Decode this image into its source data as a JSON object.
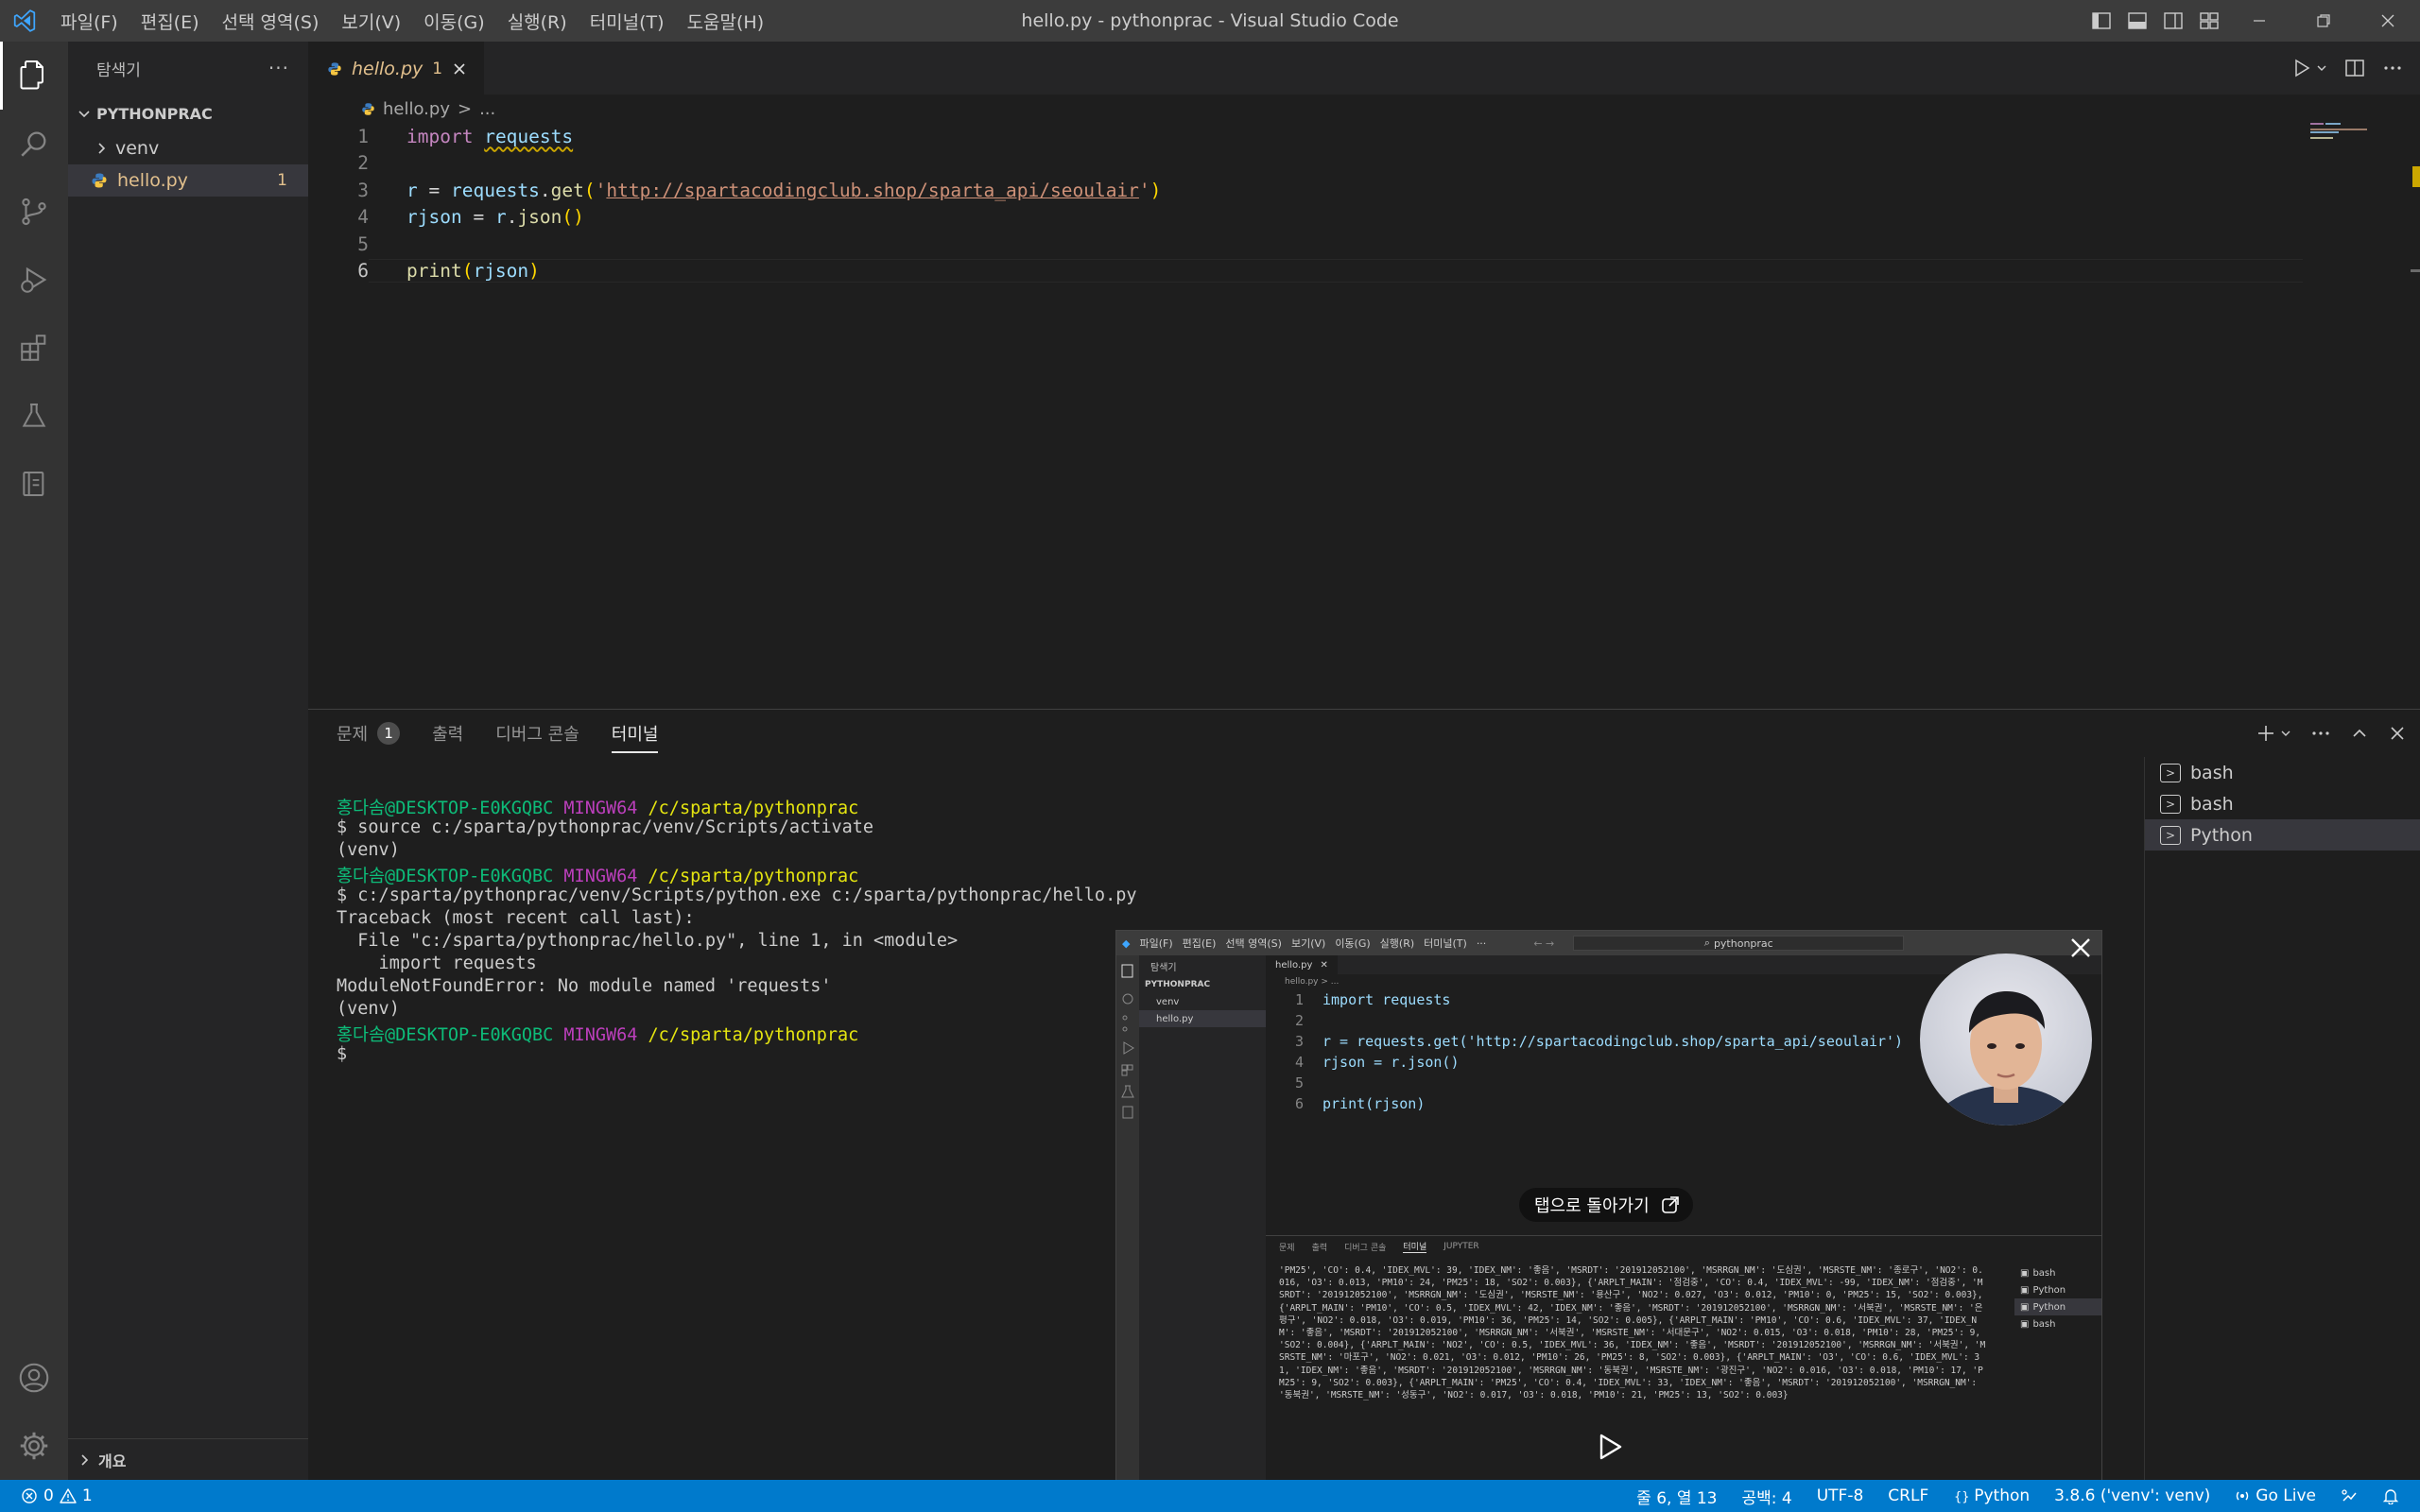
{
  "window": {
    "title": "hello.py - pythonprac - Visual Studio Code",
    "menu": [
      "파일(F)",
      "편집(E)",
      "선택 영역(S)",
      "보기(V)",
      "이동(G)",
      "실행(R)",
      "터미널(T)",
      "도움말(H)"
    ]
  },
  "sidebar": {
    "title": "탐색기",
    "more": "···",
    "folder": "PYTHONPRAC",
    "items": [
      {
        "label": "venv",
        "type": "folder"
      },
      {
        "label": "hello.py",
        "type": "file",
        "badge": "1"
      }
    ],
    "outline": "개요"
  },
  "editor": {
    "tab": {
      "name": "hello.py",
      "count": "1"
    },
    "breadcrumb": {
      "file": "hello.py",
      "sep": ">",
      "rest": "..."
    },
    "line_numbers": [
      "1",
      "2",
      "3",
      "4",
      "5",
      "6"
    ],
    "code": {
      "l1_kw": "import",
      "l1_mod": "requests",
      "l3_var": "r",
      "l3_eq": " = ",
      "l3_obj": "requests",
      "l3_dot": ".",
      "l3_fn": "get",
      "l3_open": "(",
      "l3_q1": "'",
      "l3_url": "http://spartacodingclub.shop/sparta_api/seoulair",
      "l3_q2": "'",
      "l3_close": ")",
      "l4_var": "rjson",
      "l4_eq": " = ",
      "l4_obj": "r",
      "l4_dot": ".",
      "l4_fn": "json",
      "l4_parens": "()",
      "l6_fn": "print",
      "l6_open": "(",
      "l6_arg": "rjson",
      "l6_close": ")"
    }
  },
  "panel": {
    "tabs": [
      {
        "label": "문제",
        "badge": "1"
      },
      {
        "label": "출력"
      },
      {
        "label": "디버그 콘솔"
      },
      {
        "label": "터미널",
        "active": true
      }
    ],
    "terminal": {
      "user": "홍다솜@DESKTOP-E0KGQBC",
      "host": "MINGW64",
      "path": "/c/sparta/pythonprac",
      "lines": [
        "$ source c:/sparta/pythonprac/venv/Scripts/activate",
        "(venv)",
        "$ c:/sparta/pythonprac/venv/Scripts/python.exe c:/sparta/pythonprac/hello.py",
        "Traceback (most recent call last):",
        "  File \"c:/sparta/pythonprac/hello.py\", line 1, in <module>",
        "    import requests",
        "ModuleNotFoundError: No module named 'requests'",
        "(venv)",
        "$"
      ]
    },
    "terminal_list": [
      {
        "label": "bash"
      },
      {
        "label": "bash"
      },
      {
        "label": "Python",
        "selected": true
      }
    ]
  },
  "pip": {
    "menu": [
      "파일(F)",
      "편집(E)",
      "선택 영역(S)",
      "보기(V)",
      "이동(G)",
      "실행(R)",
      "터미널(T)",
      "···"
    ],
    "search": "pythonprac",
    "folder": "PYTHONPRAC",
    "explorer": "탐색기",
    "items": [
      "venv",
      "hello.py"
    ],
    "tab": "hello.py",
    "breadcrumb": "hello.py > ...",
    "code_lines": [
      "import requests",
      "",
      "r = requests.get('http://spartacodingclub.shop/sparta_api/seoulair')",
      "rjson = r.json()",
      "",
      "print(rjson)"
    ],
    "panel_tabs": [
      "문제",
      "출력",
      "디버그 콘솔",
      "터미널",
      "JUPYTER"
    ],
    "terminal_text": "'PM25', 'CO': 0.4, 'IDEX_MVL': 39, 'IDEX_NM': '좋음', 'MSRDT': '201912052100', 'MSRRGN_NM': '도심권', 'MSRSTE_NM': '종로구', 'NO2': 0.016, 'O3': 0.013, 'PM10': 24, 'PM25': 18, 'SO2': 0.003}, {'ARPLT_MAIN': '점검중', 'CO': 0.4, 'IDEX_MVL': -99, 'IDEX_NM': '점검중', 'MSRDT': '201912052100', 'MSRRGN_NM': '도심권', 'MSRSTE_NM': '용산구', 'NO2': 0.027, 'O3': 0.012, 'PM10': 0, 'PM25': 15, 'SO2': 0.003}, {'ARPLT_MAIN': 'PM10', 'CO': 0.5, 'IDEX_MVL': 42, 'IDEX_NM': '좋음', 'MSRDT': '201912052100', 'MSRRGN_NM': '서북권', 'MSRSTE_NM': '은평구', 'NO2': 0.018, 'O3': 0.019, 'PM10': 36, 'PM25': 14, 'SO2': 0.005}, {'ARPLT_MAIN': 'PM10', 'CO': 0.6, 'IDEX_MVL': 37, 'IDEX_NM': '좋음', 'MSRDT': '201912052100', 'MSRRGN_NM': '서북권', 'MSRSTE_NM': '서대문구', 'NO2': 0.015, 'O3': 0.018, 'PM10': 28, 'PM25': 9, 'SO2': 0.004}, {'ARPLT_MAIN': 'NO2', 'CO': 0.5, 'IDEX_MVL': 36, 'IDEX_NM': '좋음', 'MSRDT': '201912052100', 'MSRRGN_NM': '서북권', 'MSRSTE_NM': '마포구', 'NO2': 0.021, 'O3': 0.012, 'PM10': 26, 'PM25': 8, 'SO2': 0.003}, {'ARPLT_MAIN': 'O3', 'CO': 0.6, 'IDEX_MVL': 31, 'IDEX_NM': '좋음', 'MSRDT': '201912052100', 'MSRRGN_NM': '동북권', 'MSRSTE_NM': '광진구', 'NO2': 0.016, 'O3': 0.018, 'PM10': 17, 'PM25': 9, 'SO2': 0.003}, {'ARPLT_MAIN': 'PM25', 'CO': 0.4, 'IDEX_MVL': 33, 'IDEX_NM': '좋음', 'MSRDT': '201912052100', 'MSRRGN_NM': '동북권', 'MSRSTE_NM': '성동구', 'NO2': 0.017, 'O3': 0.018, 'PM10': 21, 'PM25': 13, 'SO2': 0.003}",
    "terminal_list": [
      "bash",
      "Python",
      "Python",
      "bash"
    ],
    "back_label": "탭으로 돌아가기"
  },
  "statusbar": {
    "errors": "0",
    "warnings": "1",
    "position": "줄 6, 열 13",
    "spaces": "공백: 4",
    "encoding": "UTF-8",
    "eol": "CRLF",
    "language": "Python",
    "interpreter": "3.8.6 ('venv': venv)",
    "golive": "Go Live"
  },
  "colors": {
    "accent": "#007acc",
    "modified_file": "#e2c08d",
    "background": "#1e1e1e"
  }
}
